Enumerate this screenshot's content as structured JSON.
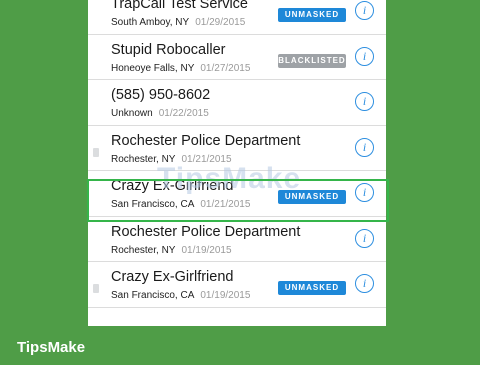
{
  "calls": [
    {
      "name": "TrapCall Test Service",
      "location": "South Amboy, NY",
      "date": "01/29/2015",
      "badge": "UNMASKED",
      "badge_color": "#1e88d8"
    },
    {
      "name": "Stupid Robocaller",
      "location": "Honeoye Falls, NY",
      "date": "01/27/2015",
      "badge": "BLACKLISTED",
      "badge_color": "#9ea2a6"
    },
    {
      "name": "(585) 950-8602",
      "location": "Unknown",
      "date": "01/22/2015",
      "badge": null
    },
    {
      "name": "Rochester Police Department",
      "location": "Rochester, NY",
      "date": "01/21/2015",
      "badge": null
    },
    {
      "name": "Crazy Ex-Girlfriend",
      "location": "San Francisco, CA",
      "date": "01/21/2015",
      "badge": "UNMASKED",
      "badge_color": "#1e88d8",
      "highlighted": true
    },
    {
      "name": "Rochester Police Department",
      "location": "Rochester, NY",
      "date": "01/19/2015",
      "badge": null
    },
    {
      "name": "Crazy Ex-Girlfriend",
      "location": "San Francisco, CA",
      "date": "01/19/2015",
      "badge": "UNMASKED",
      "badge_color": "#1e88d8"
    }
  ],
  "info_icon": "info-circle-icon",
  "watermark": "TipsMake",
  "brand": "TipsMake",
  "colors": {
    "accent": "#2e8fe0",
    "highlight": "#35b54a",
    "background": "#4f9d47"
  }
}
